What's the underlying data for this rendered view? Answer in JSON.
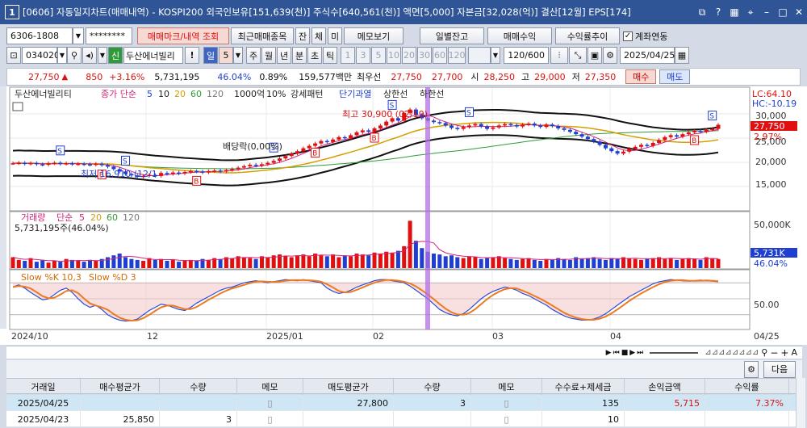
{
  "window": {
    "number": "1",
    "title": "[0606] 자동일지차트(매매내역) - KOSPI200 외국인보유[151,639(천)] 주식수[640,561(천)] 액면[5,000] 자본금[32,028(억)] 결산[12월] EPS[174]"
  },
  "toolbar1": {
    "account": "6306-1808",
    "password": "********",
    "buttons": [
      "매매마크/내역 조회",
      "최근매매종목",
      "잔",
      "체",
      "미",
      "메모보기"
    ],
    "right_buttons": [
      "일별잔고",
      "매매수익",
      "수익률추이"
    ],
    "link_label": "계좌연동"
  },
  "toolbar2": {
    "code": "034020",
    "credit_badge": "신",
    "stock_name": "두산에너빌리",
    "warn": "!",
    "period_sel": "일",
    "period_num": "5",
    "periods": [
      "주",
      "월",
      "년",
      "분",
      "초",
      "틱"
    ],
    "minutes": [
      "1",
      "3",
      "5",
      "10",
      "20",
      "30",
      "60",
      "120"
    ],
    "count": "120",
    "count_max": "/600",
    "date": "2025/04/25"
  },
  "quote": {
    "price": "27,750",
    "arrow": "▲",
    "change": "850",
    "change_pct": "+3.16%",
    "volume": "5,731,195",
    "vol_ratio": "46.04%",
    "turnover": "0.89%",
    "amount": "159,577백만",
    "best_ask_label": "최우선",
    "ask": "27,750",
    "bid": "27,700",
    "open_label": "시",
    "open": "28,250",
    "high_label": "고",
    "high": "29,000",
    "low_label": "저",
    "low": "27,350",
    "buy": "매수",
    "sell": "매도"
  },
  "chart_data": {
    "type": "candlestick",
    "legend": {
      "name": "두산에너빌리티",
      "close_label": "종가 단순",
      "mas": [
        "5",
        "10",
        "20",
        "60",
        "120"
      ],
      "extra": [
        "1000억",
        "10%",
        "강세패턴",
        "단기과열",
        "상한선",
        "하한선"
      ]
    },
    "lc": "LC:64.10",
    "hc": "HC:-10.19",
    "y_ticks": [
      "30,000",
      "25,000",
      "20,000",
      "15,000"
    ],
    "price_tag": "27,750",
    "pct_tag": "2.97%",
    "annotations": {
      "high": "최고 30,900 (02/19)",
      "low": "최저 16,910 (12/1",
      "dividend": "배당락(0,00%)"
    },
    "volume_panel": {
      "title": "거래량",
      "ma_label": "단순",
      "mas": [
        "5",
        "20",
        "60",
        "120"
      ],
      "value": "5,731,195주(46.04%)",
      "tick": "50,000K",
      "tag": "5,731K",
      "pct": "46.04%"
    },
    "stoch_panel": {
      "title": "Slow %K 10,3",
      "title2": "Slow %D 3",
      "tick": "50.00"
    },
    "x_labels": [
      "2024/10",
      "12",
      "2025/01",
      "02",
      "03",
      "04",
      "04/25"
    ],
    "closes": [
      19800,
      19900,
      19700,
      19850,
      19600,
      19500,
      19800,
      19900,
      19700,
      19800,
      19650,
      19700,
      19600,
      19500,
      19700,
      19400,
      19100,
      18600,
      18100,
      17600,
      17300,
      17000,
      17200,
      17400,
      17200,
      17800,
      17600,
      17900,
      17700,
      18000,
      18200,
      18100,
      17900,
      18200,
      18300,
      18100,
      18400,
      18600,
      18900,
      19200,
      19500,
      19300,
      19600,
      19900,
      20300,
      20800,
      21300,
      21800,
      22300,
      22900,
      23400,
      23900,
      24400,
      24200,
      24700,
      25200,
      25000,
      25600,
      26200,
      26600,
      26300,
      27000,
      27600,
      28400,
      29100,
      28600,
      30200,
      30900,
      29800,
      29100,
      28600,
      28300,
      28100,
      27600,
      27100,
      26900,
      27300,
      27600,
      27900,
      27400,
      26900,
      27200,
      27600,
      27900,
      27700,
      27400,
      27800,
      28000,
      27600,
      27300,
      27800,
      27500,
      27000,
      26700,
      26300,
      25800,
      25300,
      24800,
      24300,
      23600,
      22900,
      22300,
      21800,
      22200,
      22800,
      23200,
      23600,
      23400,
      24000,
      24600,
      25200,
      25600,
      25300,
      25800,
      26200,
      26500,
      26300,
      26700,
      26900,
      27750
    ],
    "volumes": [
      12,
      9,
      8,
      11,
      7,
      9,
      6,
      8,
      7,
      10,
      9,
      8,
      7,
      9,
      8,
      10,
      12,
      14,
      16,
      12,
      10,
      9,
      8,
      11,
      9,
      10,
      8,
      9,
      7,
      8,
      9,
      8,
      10,
      9,
      11,
      10,
      12,
      11,
      13,
      12,
      11,
      10,
      13,
      12,
      14,
      15,
      13,
      12,
      14,
      15,
      13,
      16,
      14,
      13,
      15,
      12,
      14,
      13,
      16,
      15,
      14,
      17,
      16,
      18,
      17,
      19,
      24,
      52,
      30,
      22,
      18,
      16,
      15,
      13,
      14,
      12,
      11,
      13,
      12,
      10,
      11,
      12,
      13,
      11,
      10,
      9,
      10,
      11,
      9,
      8,
      10,
      9,
      11,
      10,
      9,
      12,
      10,
      11,
      12,
      10,
      9,
      11,
      10,
      12,
      11,
      10,
      9,
      10,
      11,
      12,
      10,
      11,
      9,
      10,
      11,
      10,
      9,
      12,
      11,
      10
    ],
    "stoch": [
      72,
      76,
      70,
      62,
      55,
      48,
      50,
      58,
      66,
      70,
      62,
      50,
      40,
      34,
      38,
      30,
      20,
      14,
      10,
      8,
      9,
      12,
      20,
      28,
      34,
      40,
      38,
      34,
      30,
      28,
      34,
      42,
      48,
      54,
      60,
      66,
      70,
      72,
      76,
      80,
      82,
      84,
      82,
      80,
      82,
      84,
      86,
      85,
      84,
      86,
      84,
      82,
      80,
      70,
      64,
      60,
      62,
      66,
      72,
      76,
      80,
      84,
      86,
      86,
      84,
      82,
      80,
      74,
      66,
      58,
      50,
      40,
      30,
      24,
      20,
      18,
      22,
      30,
      40,
      50,
      58,
      64,
      68,
      72,
      70,
      66,
      60,
      56,
      50,
      44,
      38,
      30,
      24,
      18,
      14,
      12,
      10,
      10,
      12,
      16,
      22,
      30,
      38,
      46,
      54,
      60,
      66,
      72,
      78,
      82,
      84,
      86,
      85,
      84,
      83,
      84,
      85,
      84,
      83,
      82
    ]
  },
  "trade_toolbar": {
    "next_label": "다음"
  },
  "grid": {
    "columns": [
      "거래일",
      "매수평균가",
      "수량",
      "메모",
      "매도평균가",
      "수량",
      "메모",
      "수수료+제세금",
      "손익금액",
      "수익률"
    ],
    "rows": [
      {
        "date": "2025/04/25",
        "buy_avg": "",
        "buy_qty": "",
        "sell_avg": "27,800",
        "sell_qty": "3",
        "fee": "135",
        "pnl": "5,715",
        "rate": "7.37%"
      },
      {
        "date": "2025/04/23",
        "buy_avg": "25,850",
        "buy_qty": "3",
        "sell_avg": "",
        "sell_qty": "",
        "fee": "10",
        "pnl": "",
        "rate": ""
      }
    ]
  }
}
